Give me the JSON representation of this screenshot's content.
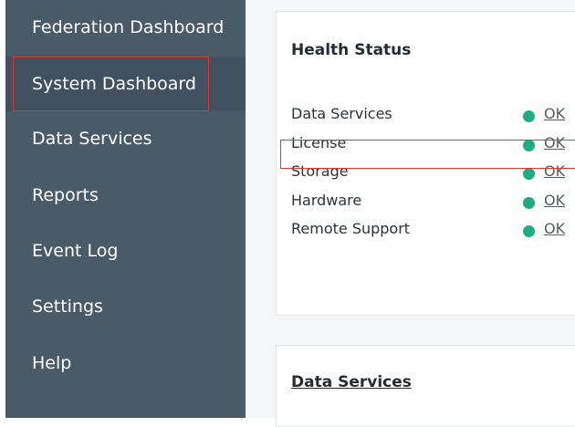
{
  "sidebar": {
    "items": [
      {
        "label": "Federation Dashboard"
      },
      {
        "label": "System Dashboard"
      },
      {
        "label": "Data Services"
      },
      {
        "label": "Reports"
      },
      {
        "label": "Event Log"
      },
      {
        "label": "Settings"
      },
      {
        "label": "Help"
      }
    ],
    "active_index": 1
  },
  "health_status": {
    "title": "Health Status",
    "rows": [
      {
        "label": "Data Services",
        "status": "OK"
      },
      {
        "label": "License",
        "status": "OK"
      },
      {
        "label": "Storage",
        "status": "OK"
      },
      {
        "label": "Hardware",
        "status": "OK"
      },
      {
        "label": "Remote Support",
        "status": "OK"
      }
    ],
    "ok_color": "#1fab84"
  },
  "data_services": {
    "title": "Data Services"
  },
  "colors": {
    "sidebar_bg": "#4a5a66",
    "highlight_outline": "#d33a3a"
  }
}
